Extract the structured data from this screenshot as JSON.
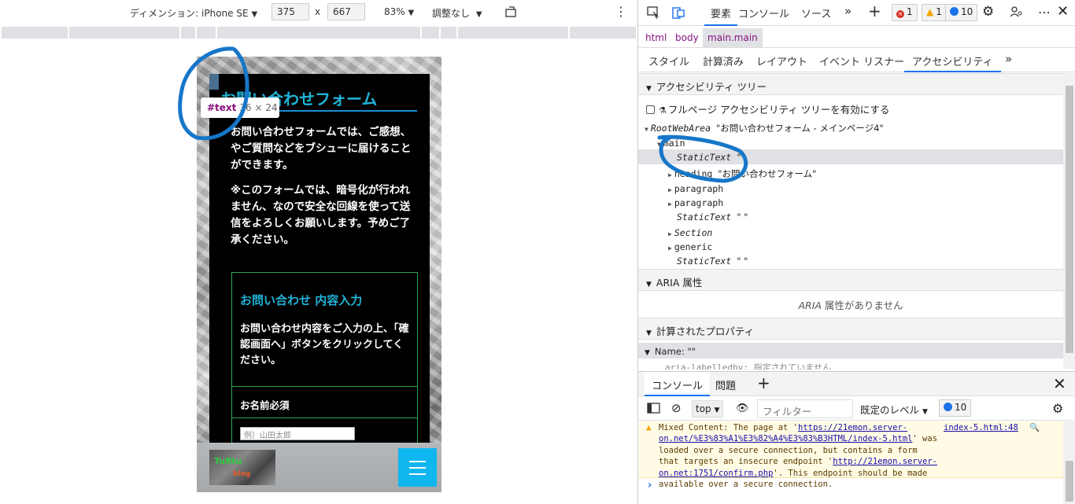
{
  "device_toolbar": {
    "dimension_label": "ディメンション: iPhone SE",
    "width": "375",
    "height": "667",
    "times": "x",
    "zoom": "83%",
    "throttle": "調整なし",
    "more": "⋮"
  },
  "phone": {
    "page_title": "お問い合わせフォーム",
    "para1": "お問い合わせフォームでは、ご感想、やご質問などをブシューに届けることができます。",
    "para2": "※このフォームでは、暗号化が行われません、なので安全な回線を使って送信をよろしくお願いします。予めご了承ください。",
    "form_heading": "お問い合わせ 内容入力",
    "form_desc": "お問い合わせ内容をご入力の上、「確認画面へ」ボタンをクリックしてください。",
    "name_label": "お名前必須",
    "name_placeholder": "例）山田太郎",
    "logo_text": "Tufitu",
    "logo_sub": "blog"
  },
  "tooltip": {
    "tag": "#text",
    "size": "36 × 24"
  },
  "devtools": {
    "tabs": {
      "elements": "要素",
      "console": "ソース",
      "console_tab": "コンソール",
      "sources": "ソース"
    },
    "badges": {
      "errors": "1",
      "warnings": "1",
      "info": "10"
    },
    "breadcrumb": [
      "html",
      "body",
      "main.main"
    ],
    "subtabs": [
      "スタイル",
      "計算済み",
      "レイアウト",
      "イベント リスナー",
      "アクセシビリティ",
      "»"
    ],
    "tree_header": "アクセシビリティ ツリー",
    "fullpage_label": "フルページ アクセシビリティ ツリーを有効にする",
    "tree": {
      "root_role": "RootWebArea",
      "root_name": "\"お問い合わせフォーム - メインページ4\"",
      "main": "main",
      "static1": "StaticText",
      "static1_val": "\"",
      "heading": "heading",
      "heading_name": "\"お問い合わせフォーム\"",
      "paragraph1": "paragraph",
      "paragraph2": "paragraph",
      "static2": "StaticText",
      "static2_val": "\"      \"",
      "section": "Section",
      "generic": "generic",
      "static3": "StaticText",
      "static3_val": "\"      \""
    },
    "aria_header": "ARIA 属性",
    "aria_empty_prefix": "ARIA",
    "aria_empty": " 属性がありません",
    "computed_header": "計算されたプロパティ",
    "computed_name": "Name: \"\"",
    "computed_sub": "aria-labelledby: 指定されていません"
  },
  "drawer": {
    "console_tab": "コンソール",
    "issues_tab": "問題",
    "context": "top",
    "filter_placeholder": "フィルター",
    "levels": "既定のレベル",
    "count": "10",
    "warning": {
      "prefix": "Mixed Content: The page at '",
      "page_url": "https://21emon.server-on.net/%E3%83%A1%E3%82%A4%E3%83%B3HTML/index-5.html",
      "mid": "' was loaded over a secure connection, but contains a form that targets an insecure endpoint '",
      "endpoint_url": "http://21emon.server-on.net:1751/confirm.php",
      "suffix": "'. This endpoint should be made available over a secure connection.",
      "source": "index-5.html:48"
    },
    "prompt": "›"
  }
}
